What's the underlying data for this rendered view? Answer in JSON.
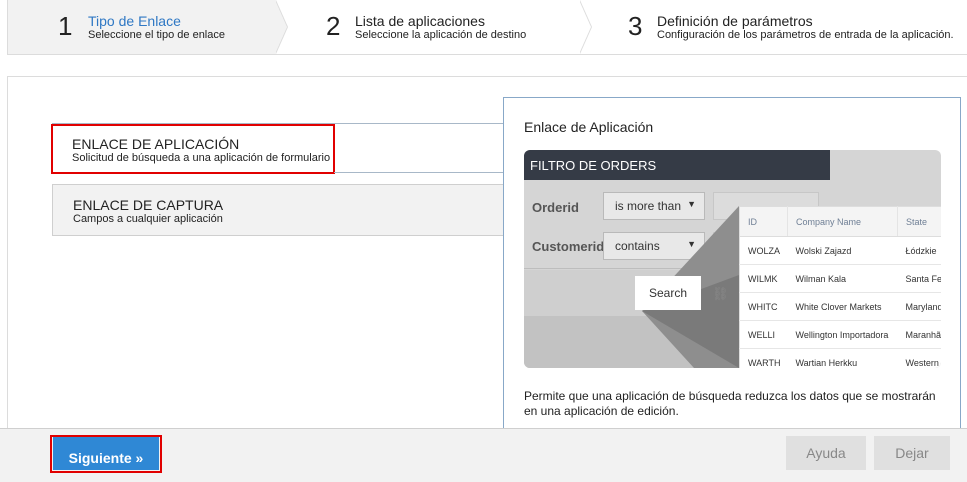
{
  "wizard": {
    "steps": [
      {
        "number": "1",
        "title": "Tipo de Enlace",
        "subtitle": "Seleccione el tipo de enlace"
      },
      {
        "number": "2",
        "title": "Lista de aplicaciones",
        "subtitle": "Seleccione la aplicación de destino"
      },
      {
        "number": "3",
        "title": "Definición de parámetros",
        "subtitle": "Configuración de los parámetros de entrada de la aplicación."
      }
    ]
  },
  "options": [
    {
      "title": "ENLACE DE APLICACIÓN",
      "subtitle": "Solicitud de búsqueda a una aplicación de formulario"
    },
    {
      "title": "ENLACE DE CAPTURA",
      "subtitle": "Campos a cualquier aplicación"
    }
  ],
  "preview": {
    "title": "Enlace de Aplicación",
    "description": "Permite que una aplicación de búsqueda reduzca los datos que se mostrarán en una aplicación de edición.",
    "illustration": {
      "filter_title": "FILTRO DE ORDERS",
      "fields": [
        {
          "label": "Orderid",
          "operator": "is more than"
        },
        {
          "label": "Customerid",
          "operator": "contains"
        }
      ],
      "search_label": "Search",
      "table": {
        "headers": [
          "ID",
          "Company Name",
          "State"
        ],
        "rows": [
          [
            "WOLZA",
            "Wolski Zajazd",
            "Łódzkie"
          ],
          [
            "WILMK",
            "Wilman Kala",
            "Santa Fe"
          ],
          [
            "WHITC",
            "White Clover Markets",
            "Maryland"
          ],
          [
            "WELLI",
            "Wellington Importadora",
            "Maranhão"
          ],
          [
            "WARTH",
            "Wartian Herkku",
            "Western"
          ]
        ]
      }
    }
  },
  "footer": {
    "next_label": "Siguiente »",
    "help_label": "Ayuda",
    "exit_label": "Dejar"
  },
  "colors": {
    "active_step": "#2f78c4",
    "primary_button": "#2f88d5",
    "highlight": "#e10000"
  }
}
